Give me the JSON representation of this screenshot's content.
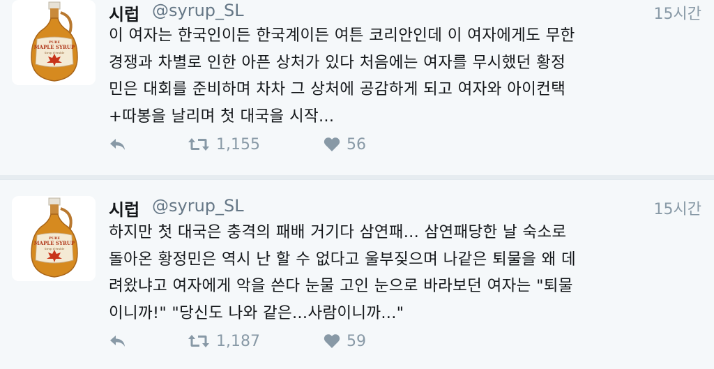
{
  "tweets": [
    {
      "name": "시럽",
      "handle": "@syrup_SL",
      "time": "15시간",
      "lines": [
        "이 여자는 한국인이든 한국계이든 여튼 코리안인데 이 여자에게도 무한",
        "경쟁과 차별로 인한 아픈 상처가 있다 처음에는 여자를 무시했던 황정",
        "민은 대회를 준비하며 차차 그 상처에 공감하게 되고 여자와 아이컨택",
        "+따봉을 날리며 첫 대국을 시작..."
      ],
      "retweets": "1,155",
      "likes": "56"
    },
    {
      "name": "시럽",
      "handle": "@syrup_SL",
      "time": "15시간",
      "lines": [
        "하지만 첫 대국은 충격의 패배 거기다 삼연패... 삼연패당한 날 숙소로",
        "돌아온 황정민은 역시 난 할 수 없다고 울부짖으며 나같은 퇴물을 왜 데",
        "려왔냐고 여자에게 악을 쓴다 눈물 고인 눈으로 바라보던 여자는 \"퇴물",
        "이니까!\" \"당신도 나와 같은...사람이니까...\""
      ],
      "retweets": "1,187",
      "likes": "59"
    }
  ],
  "avatar_label": {
    "top": "PURE",
    "main": "MAPLE SYRUP",
    "sub": "Sirop d'érable"
  },
  "icons": {
    "reply": "reply-icon",
    "retweet": "retweet-icon",
    "like": "heart-icon"
  },
  "colors": {
    "background": "#f5f8fa",
    "text": "#14171a",
    "muted": "#8899a6",
    "syrup": "#d4861e"
  }
}
